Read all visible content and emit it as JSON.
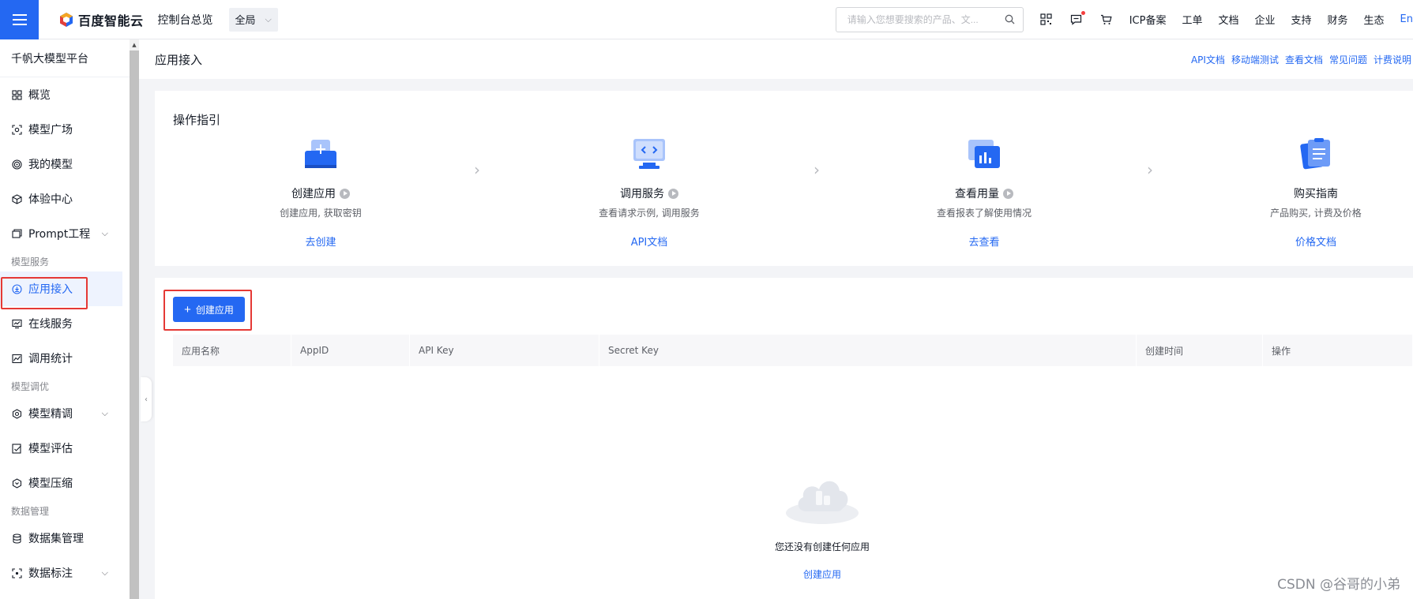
{
  "topbar": {
    "brand": "百度智能云",
    "console": "控制台总览",
    "scope": "全局",
    "search_placeholder": "请输入您想要搜索的产品、文...",
    "links": [
      "ICP备案",
      "工单",
      "文档",
      "企业",
      "支持",
      "财务",
      "生态"
    ],
    "lang": "En"
  },
  "sidebar": {
    "title": "千帆大模型平台",
    "items": [
      {
        "label": "概览",
        "icon": "grid-icon"
      },
      {
        "label": "模型广场",
        "icon": "scan-icon"
      },
      {
        "label": "我的模型",
        "icon": "target-icon"
      },
      {
        "label": "体验中心",
        "icon": "cube-icon"
      },
      {
        "label": "Prompt工程",
        "icon": "prompt-icon",
        "expandable": true
      }
    ],
    "group_model_service": "模型服务",
    "service_items": [
      {
        "label": "应用接入",
        "icon": "download-icon",
        "active": true
      },
      {
        "label": "在线服务",
        "icon": "monitor-icon"
      },
      {
        "label": "调用统计",
        "icon": "chart-icon"
      }
    ],
    "group_model_tuning": "模型调优",
    "tuning_items": [
      {
        "label": "模型精调",
        "icon": "settings-icon",
        "expandable": true
      },
      {
        "label": "模型评估",
        "icon": "evaluate-icon"
      },
      {
        "label": "模型压缩",
        "icon": "compress-icon"
      }
    ],
    "group_data": "数据管理",
    "data_items": [
      {
        "label": "数据集管理",
        "icon": "database-icon"
      },
      {
        "label": "数据标注",
        "icon": "label-icon",
        "expandable": true
      }
    ]
  },
  "page": {
    "title": "应用接入",
    "head_links": [
      "API文档",
      "移动端测试",
      "查看文档",
      "常见问题",
      "计费说明"
    ]
  },
  "guide": {
    "title": "操作指引",
    "steps": [
      {
        "name": "创建应用",
        "desc": "创建应用, 获取密钥",
        "link": "去创建",
        "video": true
      },
      {
        "name": "调用服务",
        "desc": "查看请求示例, 调用服务",
        "link": "API文档",
        "video": true
      },
      {
        "name": "查看用量",
        "desc": "查看报表了解使用情况",
        "link": "去查看",
        "video": true
      },
      {
        "name": "购买指南",
        "desc": "产品购买, 计费及价格",
        "link": "价格文档",
        "video": false
      }
    ]
  },
  "table": {
    "create_button": "创建应用",
    "columns": [
      "应用名称",
      "AppID",
      "API Key",
      "Secret Key",
      "创建时间",
      "操作"
    ],
    "empty_text": "您还没有创建任何应用",
    "empty_link": "创建应用"
  },
  "watermark": "CSDN @谷哥的小弟",
  "colors": {
    "accent": "#2468f2",
    "highlight": "#e53935"
  }
}
